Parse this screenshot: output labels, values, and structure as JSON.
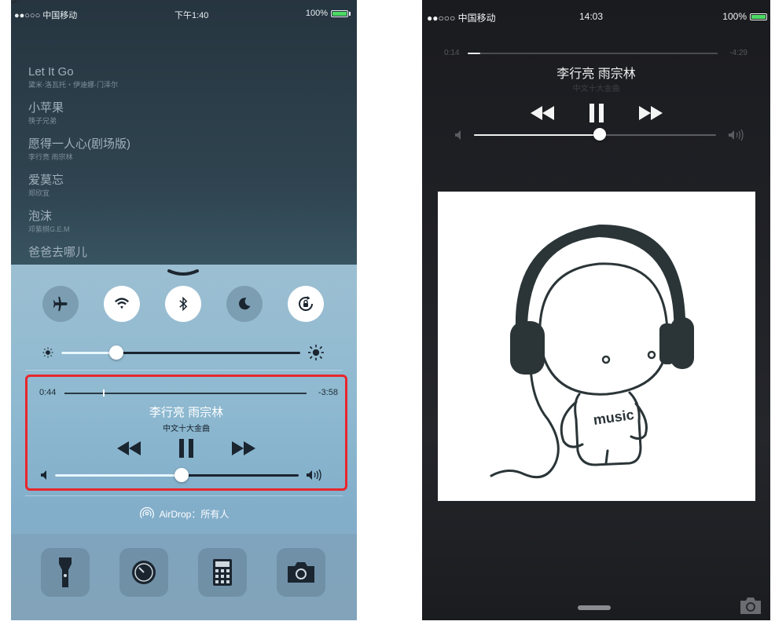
{
  "left": {
    "top_crop_text": "5.",
    "status": {
      "carrier": "●●○○○ 中国移动",
      "time": "下午1:40",
      "battery": "100%"
    },
    "songs": [
      {
        "title": "Let It Go",
        "artist": "黛米·洛瓦托・伊迪娜·门泽尔"
      },
      {
        "title": "小苹果",
        "artist": "筷子兄弟"
      },
      {
        "title": "愿得一人心(剧场版)",
        "artist": "李行亮 雨宗林"
      },
      {
        "title": "爱莫忘",
        "artist": "郑欣宜"
      },
      {
        "title": "泡沫",
        "artist": "邓紫棋G.E.M"
      },
      {
        "title": "爸爸去哪儿",
        "artist": ""
      }
    ],
    "toggles": [
      {
        "icon": "airplane-icon",
        "state": "off"
      },
      {
        "icon": "wifi-icon",
        "state": "on"
      },
      {
        "icon": "bluetooth-icon",
        "state": "on"
      },
      {
        "icon": "moon-icon",
        "state": "off"
      },
      {
        "icon": "rotation-lock-icon",
        "state": "on"
      }
    ],
    "brightness": 0.23,
    "player": {
      "elapsed": "0:44",
      "remaining": "-3:58",
      "title": "李行亮 雨宗林",
      "album": "中文十大金曲",
      "volume": 0.52,
      "progress": 0.16
    },
    "airdrop_label": "AirDrop：所有人",
    "shortcuts": [
      "flashlight-icon",
      "timer-icon",
      "calculator-icon",
      "camera-icon"
    ],
    "highlight_color": "#e8262b"
  },
  "right": {
    "status": {
      "carrier": "●●○○○ 中国移动",
      "time": "14:03",
      "battery": "100%"
    },
    "player": {
      "elapsed": "0:14",
      "remaining": "-4:29",
      "title": "李行亮 雨宗林",
      "album": "中文十大金曲",
      "volume": 0.52,
      "progress": 0.05
    },
    "artwork_text": "music"
  }
}
